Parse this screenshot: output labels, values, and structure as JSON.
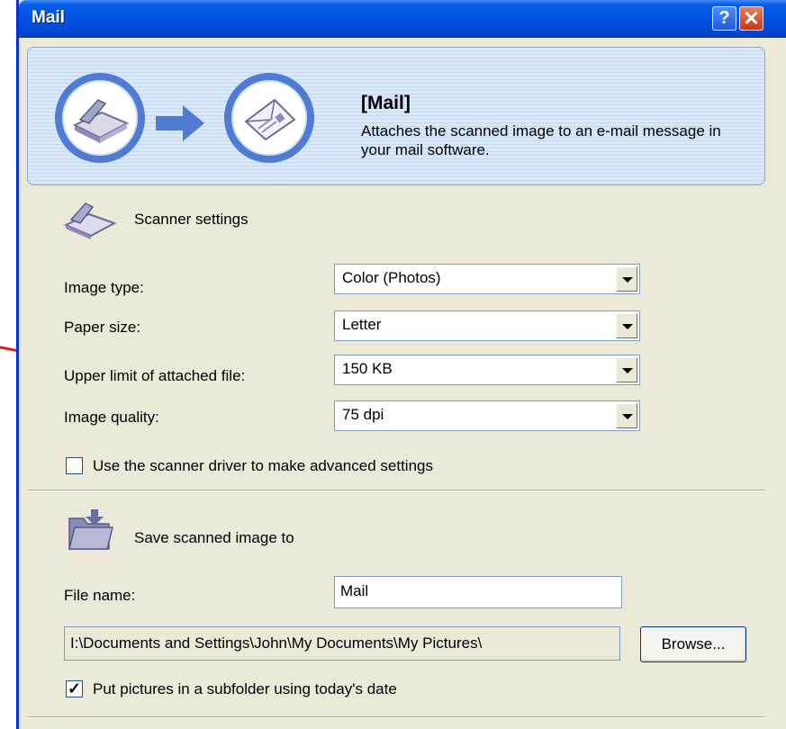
{
  "window": {
    "title": "Mail"
  },
  "banner": {
    "title": "[Mail]",
    "description": "Attaches the scanned image to an e-mail message in your mail software."
  },
  "scanner_section": {
    "title": "Scanner settings",
    "fields": [
      {
        "label": "Image type:",
        "value": "Color (Photos)"
      },
      {
        "label": "Paper size:",
        "value": "Letter"
      },
      {
        "label": "Upper limit of attached file:",
        "value": "150 KB"
      },
      {
        "label": "Image quality:",
        "value": "75 dpi"
      }
    ],
    "advanced_checkbox": {
      "label": "Use the scanner driver to make advanced settings",
      "checked": false
    }
  },
  "save_section": {
    "title": "Save scanned image to",
    "file_name_label": "File name:",
    "file_name_value": "Mail",
    "path": "I:\\Documents and Settings\\John\\My Documents\\My Pictures\\",
    "browse_label": "Browse...",
    "subfolder_checkbox": {
      "label": "Put pictures in a subfolder using today's date",
      "checked": true,
      "mark": "✓"
    }
  },
  "colors": {
    "titlebar": "#0055e5",
    "dialog_bg": "#ece9d8",
    "accent": "#4f7bd3",
    "pointer": "#e41b17"
  },
  "icons": [
    "scanner-icon",
    "arrow-icon",
    "mail-icon",
    "folder-icon",
    "help-icon",
    "close-icon"
  ]
}
